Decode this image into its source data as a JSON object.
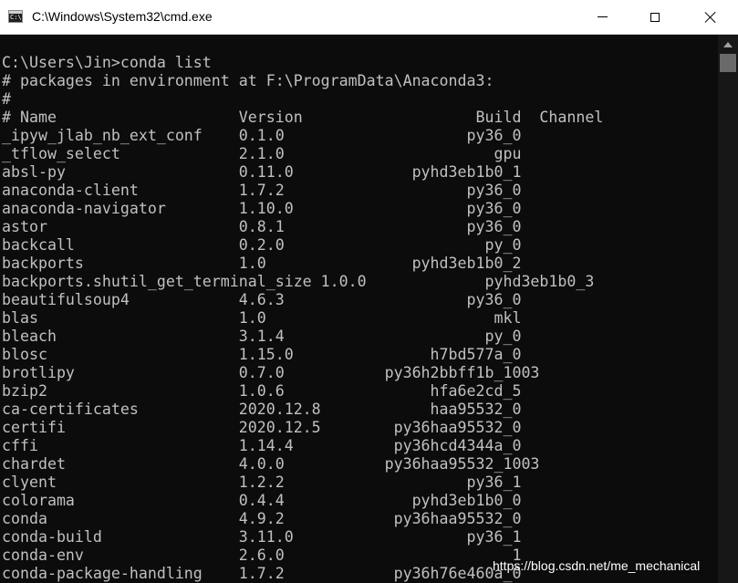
{
  "window": {
    "title": "C:\\Windows\\System32\\cmd.exe",
    "icon": "cmd-icon",
    "controls": [
      "minimize",
      "maximize",
      "close"
    ]
  },
  "console": {
    "lines": [
      "",
      "C:\\Users\\Jin>conda list",
      "# packages in environment at F:\\ProgramData\\Anaconda3:",
      "#",
      "# Name                    Version                   Build  Channel",
      "_ipyw_jlab_nb_ext_conf    0.1.0                    py36_0",
      "_tflow_select             2.1.0                       gpu",
      "absl-py                   0.11.0             pyhd3eb1b0_1",
      "anaconda-client           1.7.2                    py36_0",
      "anaconda-navigator        1.10.0                   py36_0",
      "astor                     0.8.1                    py36_0",
      "backcall                  0.2.0                      py_0",
      "backports                 1.0                pyhd3eb1b0_2",
      "backports.shutil_get_terminal_size 1.0.0             pyhd3eb1b0_3",
      "beautifulsoup4            4.6.3                    py36_0",
      "blas                      1.0                         mkl",
      "bleach                    3.1.4                      py_0",
      "blosc                     1.15.0               h7bd577a_0",
      "brotlipy                  0.7.0           py36h2bbff1b_1003",
      "bzip2                     1.0.6                hfa6e2cd_5",
      "ca-certificates           2020.12.8            haa95532_0",
      "certifi                   2020.12.5        py36haa95532_0",
      "cffi                      1.14.4           py36hcd4344a_0",
      "chardet                   4.0.0           py36haa95532_1003",
      "clyent                    1.2.2                    py36_1",
      "colorama                  0.4.4              pyhd3eb1b0_0",
      "conda                     4.9.2            py36haa95532_0",
      "conda-build               3.11.0                   py36_1",
      "conda-env                 2.6.0                         1",
      "conda-package-handling    1.7.2            py36h76e460a_0"
    ]
  },
  "watermark": "https://blog.csdn.net/me_mechanical"
}
